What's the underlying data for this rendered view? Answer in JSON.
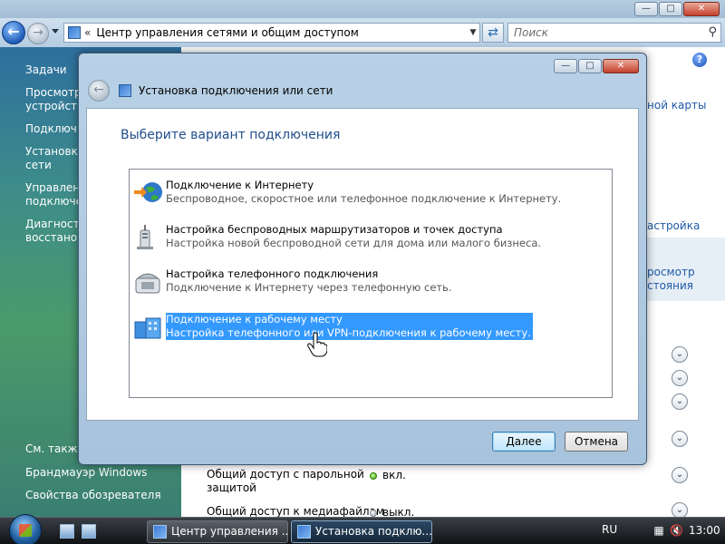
{
  "explorer": {
    "window_buttons": {
      "minimize": "—",
      "maximize": "□",
      "close": "✕"
    },
    "address": {
      "prefix": "«",
      "path": "Центр управления сетями и общим доступом"
    },
    "search": {
      "placeholder": "Поиск"
    },
    "help_label": "?"
  },
  "tasks_pane": {
    "title": "Задачи",
    "items": [
      {
        "label": "Просмотр устройств"
      },
      {
        "label": "Подключ..."
      },
      {
        "label": "Установка сети"
      },
      {
        "label": "Управлени подключе..."
      },
      {
        "label": "Диагностика восстанов..."
      }
    ],
    "see_also_title": "См. также",
    "see_also": [
      {
        "label": "Брандмауэр Windows"
      },
      {
        "label": "Свойства обозревателя"
      }
    ]
  },
  "content": {
    "map_link": "ной карты",
    "config_link": "астройка",
    "status_link_line1": "росмотр",
    "status_link_line2": "стояния",
    "sharing": [
      {
        "label_line1": "Общий доступ с парольной",
        "label_line2": "защитой",
        "status": "вкл.",
        "state": "on"
      },
      {
        "label_line1": "Общий доступ к медиафайлам",
        "label_line2": "",
        "status": "выкл.",
        "state": "off"
      }
    ]
  },
  "dialog": {
    "title": "Установка подключения или сети",
    "heading": "Выберите вариант подключения",
    "options": [
      {
        "title": "Подключение к Интернету",
        "desc": "Беспроводное, скоростное или телефонное подключение к Интернету.",
        "icon": "globe-icon",
        "selected": false
      },
      {
        "title": "Настройка беспроводных маршрутизаторов и точек доступа",
        "desc": "Настройка новой беспроводной сети для дома или малого бизнеса.",
        "icon": "router-icon",
        "selected": false
      },
      {
        "title": "Настройка телефонного подключения",
        "desc": "Подключение к Интернету через телефонную сеть.",
        "icon": "phone-icon",
        "selected": false
      },
      {
        "title": "Подключение к рабочему месту",
        "desc": "Настройка телефонного или VPN-подключения к рабочему месту.",
        "icon": "workplace-icon",
        "selected": true
      }
    ],
    "buttons": {
      "next": "Далее",
      "cancel": "Отмена"
    },
    "window_buttons": {
      "minimize": "—",
      "maximize": "□",
      "close": "✕"
    }
  },
  "taskbar": {
    "tasks": [
      {
        "label": "Центр управления ...",
        "active": false
      },
      {
        "label": "Установка подклю...",
        "active": true
      }
    ],
    "language": "RU",
    "clock": "13:00"
  },
  "colors": {
    "selection": "#3399ff",
    "link": "#1e5aa8",
    "heading": "#1f4d8c"
  }
}
